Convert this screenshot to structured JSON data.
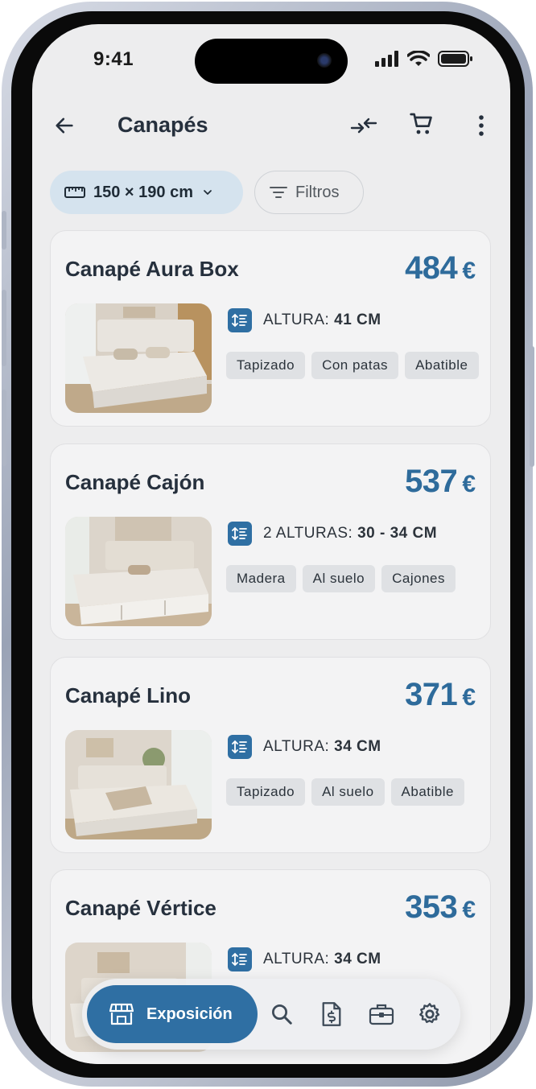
{
  "status": {
    "time": "9:41"
  },
  "appbar": {
    "title": "Canapés"
  },
  "filters": {
    "size_label": "150 × 190 cm",
    "filters_label": "Filtros"
  },
  "products": [
    {
      "name": "Canapé Aura Box",
      "price": "484",
      "currency": "€",
      "spec_prefix": "ALTURA:",
      "spec_value": "41 CM",
      "tags": [
        "Tapizado",
        "Con patas",
        "Abatible"
      ]
    },
    {
      "name": "Canapé Cajón",
      "price": "537",
      "currency": "€",
      "spec_prefix": "2 ALTURAS:",
      "spec_value": "30 - 34 CM",
      "tags": [
        "Madera",
        "Al suelo",
        "Cajones"
      ]
    },
    {
      "name": "Canapé Lino",
      "price": "371",
      "currency": "€",
      "spec_prefix": "ALTURA:",
      "spec_value": "34 CM",
      "tags": [
        "Tapizado",
        "Al suelo",
        "Abatible"
      ]
    },
    {
      "name": "Canapé Vértice",
      "price": "353",
      "currency": "€",
      "spec_prefix": "ALTURA:",
      "spec_value": "34 CM",
      "tags": []
    }
  ],
  "bottom_nav": {
    "active_label": "Exposición"
  },
  "colors": {
    "accent": "#2f6fa3",
    "price": "#2e6b9b",
    "chip_bg": "#d5e3ee",
    "tag_bg": "#dfe1e4"
  }
}
